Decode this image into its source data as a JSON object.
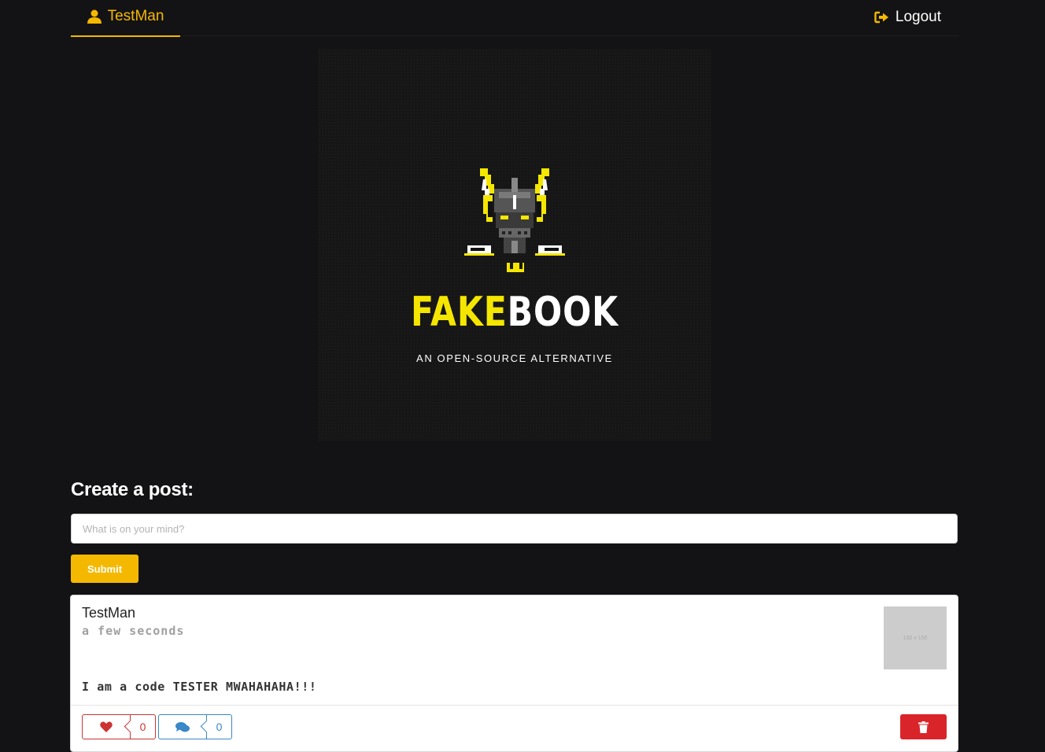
{
  "nav": {
    "user_label": "TestMan",
    "user_icon": "user-icon",
    "logout_label": "Logout",
    "logout_icon": "sign-out-icon",
    "accent_color": "#f5b800"
  },
  "hero": {
    "logo_icon": "samurai-mask-logo",
    "brand_part1": "FAKE",
    "brand_part2": "BOOK",
    "tagline": "AN OPEN-SOURCE ALTERNATIVE"
  },
  "create": {
    "title": "Create a post:",
    "placeholder": "What is on your mind?",
    "value": "",
    "submit_label": "Submit"
  },
  "posts": [
    {
      "author": "TestMan",
      "time": "a few seconds",
      "thumb_label": "150 x 150",
      "body": "I am a code TESTER MWAHAHAHA!!!",
      "likes": "0",
      "comments": "0",
      "like_icon": "heart-icon",
      "comment_icon": "comments-icon",
      "delete_icon": "trash-icon"
    }
  ],
  "colors": {
    "background": "#131315",
    "brand_yellow": "#f5e600",
    "like_red": "#cc3333",
    "comment_blue": "#3a87c9",
    "delete_red": "#d9252a"
  }
}
